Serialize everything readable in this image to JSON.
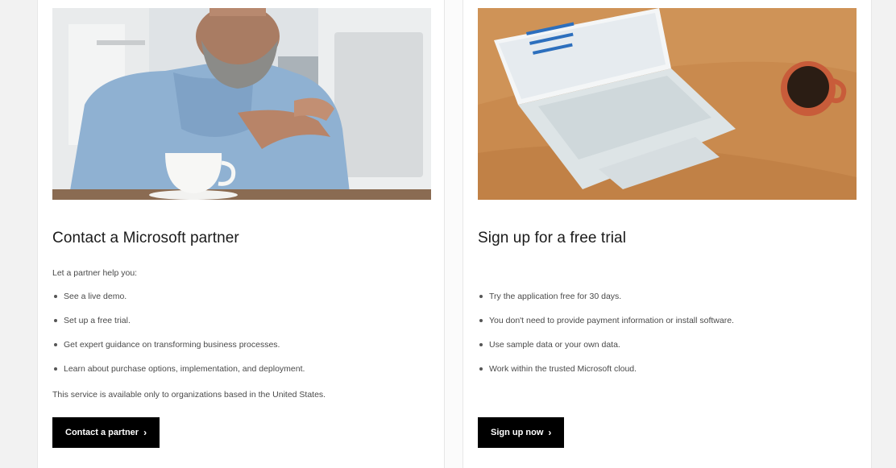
{
  "cards": [
    {
      "image_icon": "photo-man-with-coffee",
      "title": "Contact a Microsoft partner",
      "intro": "Let a partner help you:",
      "bullets": [
        "See a live demo.",
        "Set up a free trial.",
        "Get expert guidance on transforming business processes.",
        "Learn about purchase options, implementation, and deployment."
      ],
      "note": "This service is available only to organizations based in the United States.",
      "cta_label": "Contact a partner",
      "cta_icon": "chevron-right-icon"
    },
    {
      "image_icon": "photo-laptop-on-desk",
      "title": "Sign up for a free trial",
      "intro": "",
      "bullets": [
        "Try the application free for 30 days.",
        "You don't need to provide payment information or install software.",
        "Use sample data or your own data.",
        "Work within the trusted Microsoft cloud."
      ],
      "cta_label": "Sign up now",
      "cta_icon": "chevron-right-icon"
    }
  ],
  "colors": {
    "cta_background": "#000000",
    "cta_text": "#ffffff",
    "title_text": "#1a1a1a",
    "body_text": "#4a4a4a"
  }
}
